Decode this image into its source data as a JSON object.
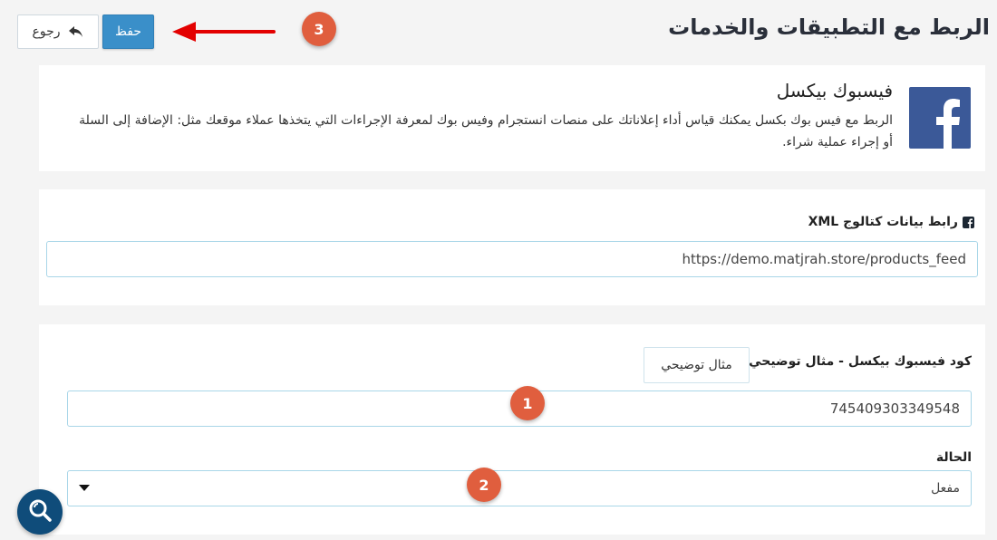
{
  "header": {
    "title": "الربط مع التطبيقات والخدمات",
    "save_label": "حفظ",
    "back_label": "رجوع"
  },
  "facebook": {
    "title": "فيسبوك بيكسل",
    "description": "الربط مع فيس بوك بكسل يمكنك قياس أداء إعلاناتك على منصات انستجرام وفيس بوك لمعرفة الإجراءات التي يتخذها عملاء موقعك مثل: الإضافة إلى السلة أو إجراء عملية شراء."
  },
  "xml_feed": {
    "label": "رابط بيانات كتالوج XML",
    "value": "https://demo.matjrah.store/products_feed"
  },
  "pixel": {
    "label": "كود فيسبوك بيكسل - مثال توضيحي:",
    "example_button": "مثال توضيحي",
    "value": "745409303349548"
  },
  "status": {
    "label": "الحالة",
    "selected": "مفعل"
  },
  "annotations": {
    "badge_1": "1",
    "badge_2": "2",
    "badge_3": "3"
  },
  "colors": {
    "primary": "#3a8fc9",
    "badge": "#e05e3e",
    "facebook": "#3b5998",
    "arrow": "#e30000",
    "fab": "#0f4c7a"
  },
  "icons": {
    "back": "reply-arrow-icon",
    "facebook": "facebook-logo-icon",
    "facebook_square": "facebook-square-icon",
    "dropdown": "caret-down-icon",
    "search": "search-icon"
  }
}
